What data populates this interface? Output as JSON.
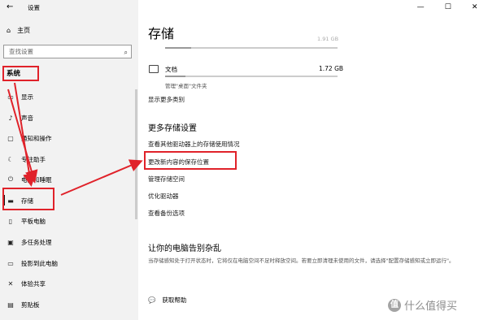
{
  "window": {
    "title": "设置",
    "controls": {
      "minimize": "—",
      "maximize": "☐",
      "close": "✕"
    }
  },
  "sidebar": {
    "back_icon": "←",
    "home_label": "主页",
    "search_placeholder": "查找设置",
    "section_title": "系统",
    "items": [
      {
        "label": "显示",
        "icon": "display-icon"
      },
      {
        "label": "声音",
        "icon": "sound-icon"
      },
      {
        "label": "通知和操作",
        "icon": "notification-icon"
      },
      {
        "label": "专注助手",
        "icon": "focus-icon"
      },
      {
        "label": "电源和睡眠",
        "icon": "power-icon"
      },
      {
        "label": "存储",
        "icon": "storage-icon"
      },
      {
        "label": "平板电脑",
        "icon": "tablet-icon"
      },
      {
        "label": "多任务处理",
        "icon": "multitask-icon"
      },
      {
        "label": "投影到此电脑",
        "icon": "project-icon"
      },
      {
        "label": "体验共享",
        "icon": "share-icon"
      },
      {
        "label": "剪贴板",
        "icon": "clipboard-icon"
      }
    ]
  },
  "main": {
    "title": "存储",
    "storage_rows": [
      {
        "label": "",
        "size": "1.91 GB",
        "sub": "",
        "fill": 0.15
      },
      {
        "label": "文档",
        "size": "1.72 GB",
        "sub": "管理\"桌面\"文件夹",
        "fill": 0.12
      }
    ],
    "show_more": "显示更多类别",
    "more_title": "更多存储设置",
    "more_links": [
      "查看其他驱动器上的存储使用情况",
      "更改新内容的保存位置",
      "管理存储空间",
      "优化驱动器",
      "查看备份选项"
    ],
    "privacy_title": "让你的电脑告别杂乱",
    "privacy_text": "当存储感知处于打开状态时，它将仅在电脑空间不足时释放空间。若要立即清理未使用的文件，请选择\"配置存储感知或立即运行\"。",
    "help_label": "获取帮助"
  },
  "watermark": {
    "badge": "值",
    "text": "什么值得买"
  }
}
